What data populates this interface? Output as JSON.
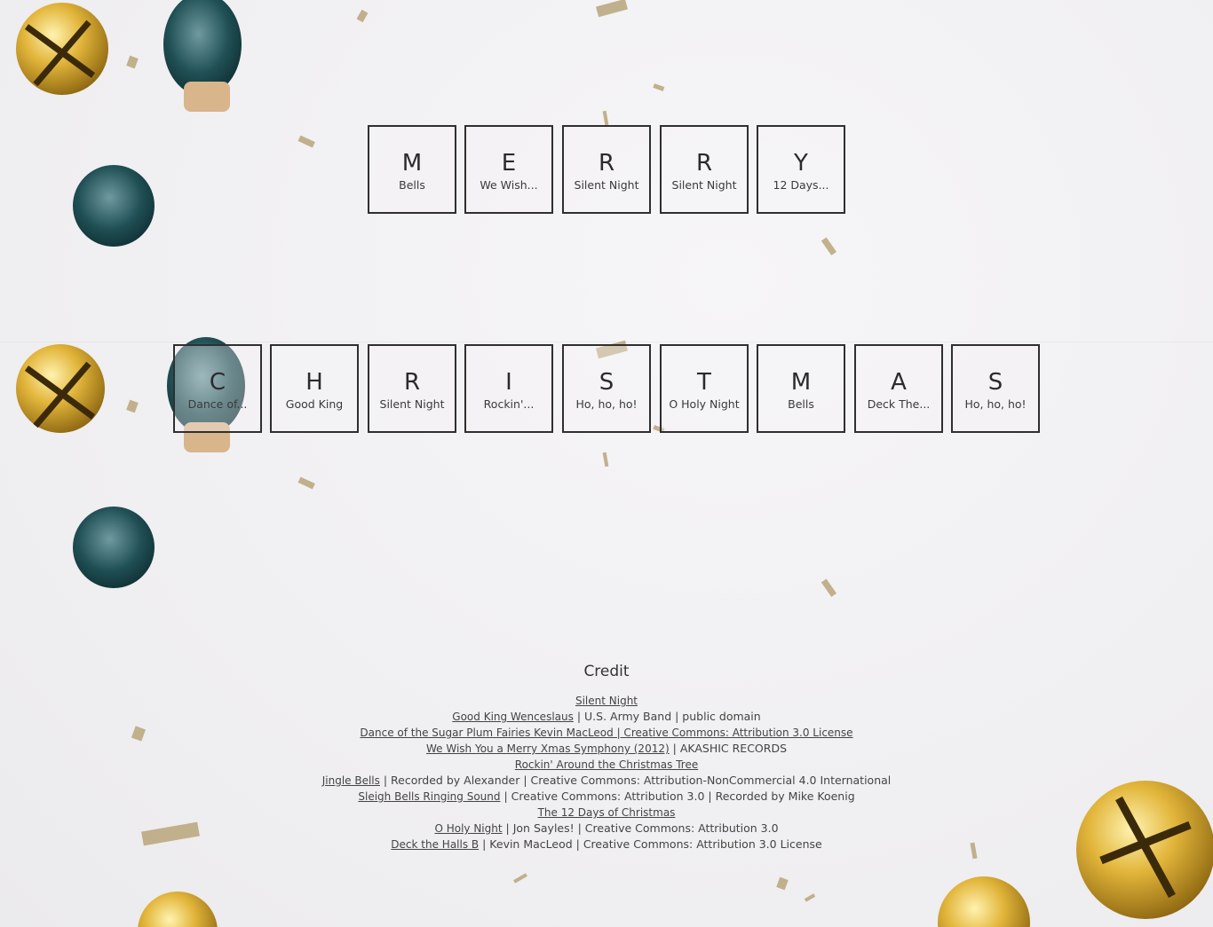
{
  "rows": [
    {
      "tiles": [
        {
          "letter": "M",
          "song": "Bells"
        },
        {
          "letter": "E",
          "song": "We Wish..."
        },
        {
          "letter": "R",
          "song": "Silent Night"
        },
        {
          "letter": "R",
          "song": "Silent Night"
        },
        {
          "letter": "Y",
          "song": "12 Days..."
        }
      ]
    },
    {
      "tiles": [
        {
          "letter": "C",
          "song": "Dance of..."
        },
        {
          "letter": "H",
          "song": "Good King"
        },
        {
          "letter": "R",
          "song": "Silent Night"
        },
        {
          "letter": "I",
          "song": "Rockin'..."
        },
        {
          "letter": "S",
          "song": "Ho, ho, ho!"
        },
        {
          "letter": "T",
          "song": "O Holy Night"
        },
        {
          "letter": "M",
          "song": "Bells"
        },
        {
          "letter": "A",
          "song": "Deck The..."
        },
        {
          "letter": "S",
          "song": "Ho, ho, ho!"
        }
      ]
    }
  ],
  "credit": {
    "title": "Credit",
    "lines": [
      {
        "link": "Silent Night",
        "rest": ""
      },
      {
        "link": "Good King Wenceslaus",
        "rest": " | U.S. Army Band | public domain"
      },
      {
        "link": "Dance of the Sugar Plum Fairies Kevin MacLeod | Creative Commons: Attribution 3.0 License",
        "rest": ""
      },
      {
        "link": "We Wish You a Merry Xmas Symphony (2012)",
        "rest": " | AKASHIC RECORDS"
      },
      {
        "link": "Rockin' Around the Christmas Tree",
        "rest": ""
      },
      {
        "link": "Jingle Bells",
        "rest": " | Recorded by Alexander | Creative Commons: Attribution-NonCommercial 4.0 International"
      },
      {
        "link": "Sleigh Bells Ringing Sound",
        "rest": " | Creative Commons: Attribution 3.0 | Recorded by Mike Koenig"
      },
      {
        "link": "The 12 Days of Christmas",
        "rest": ""
      },
      {
        "link": "O Holy Night",
        "rest": " | Jon Sayles! | Creative Commons: Attribution 3.0"
      },
      {
        "link": "Deck the Halls B",
        "rest": " | Kevin MacLeod | Creative Commons: Attribution 3.0 License"
      }
    ]
  }
}
